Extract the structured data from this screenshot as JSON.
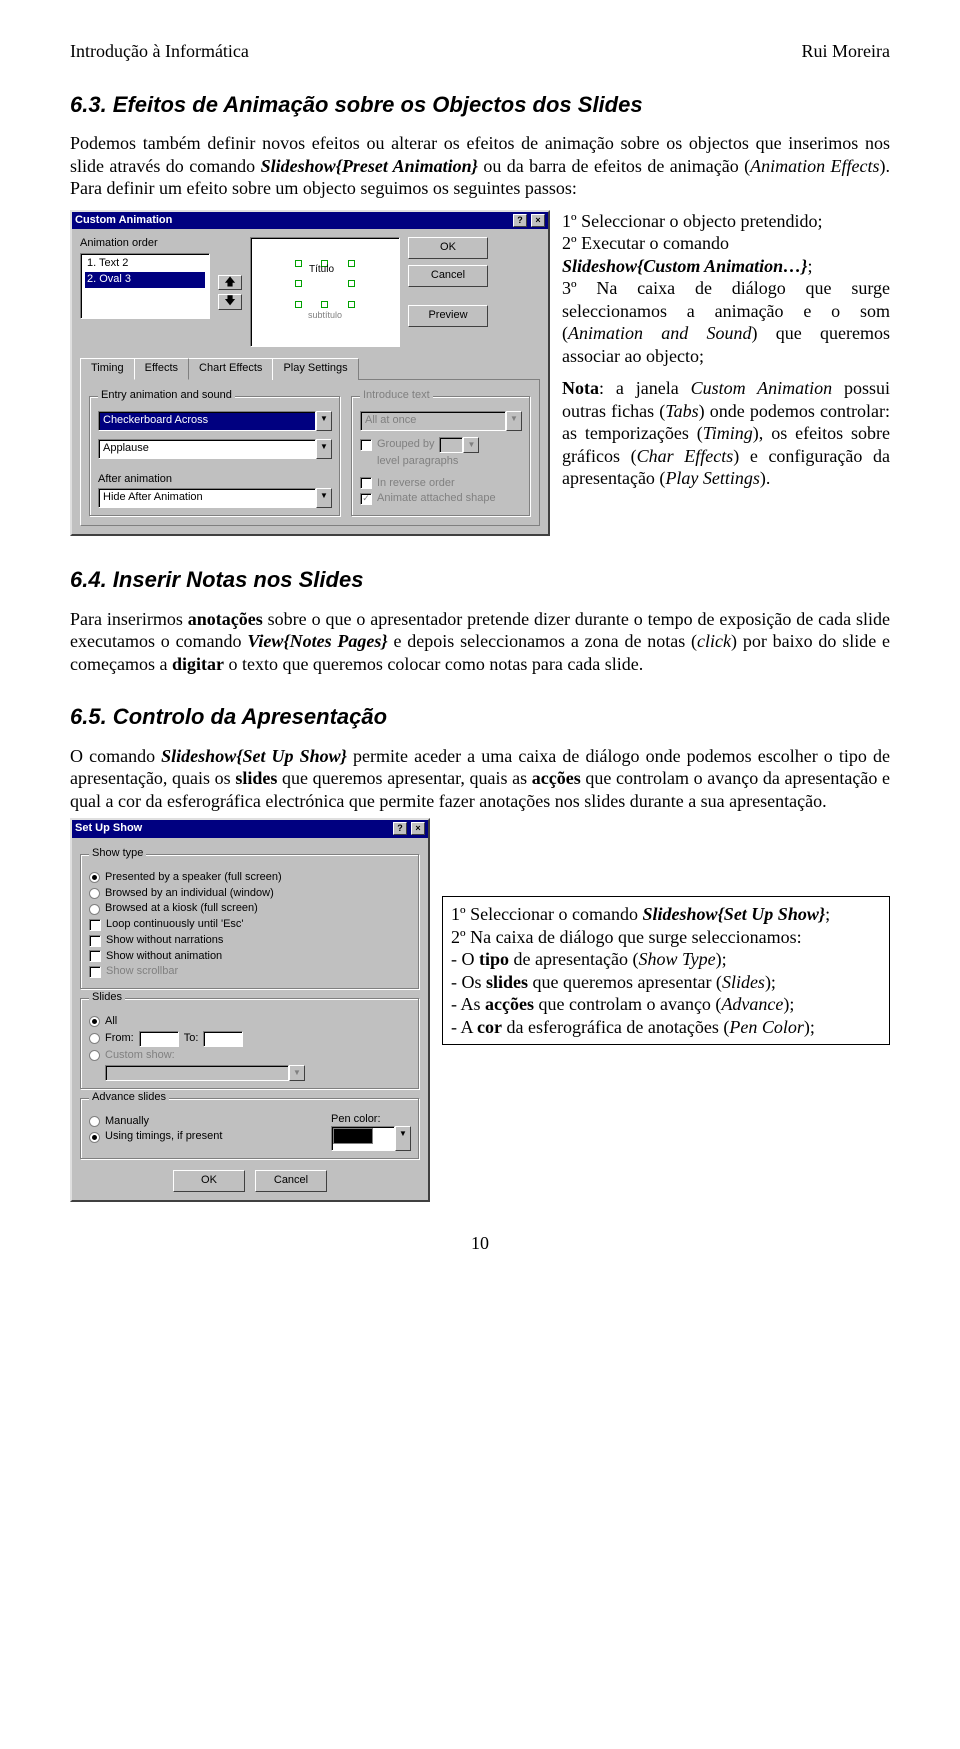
{
  "header": {
    "left": "Introdução à Informática",
    "right": "Rui Moreira"
  },
  "sec63": {
    "title": "6.3. Efeitos de Animação sobre os Objectos dos Slides",
    "p1a": "Podemos também definir novos efeitos ou alterar os efeitos de animação sobre os objectos que inserimos nos slide através do comando ",
    "p1b": "Slideshow{Preset Animation}",
    "p1c": " ou da barra de efeitos de animação (",
    "p1d": "Animation Effects",
    "p1e": "). Para definir um efeito sobre um objecto seguimos os seguintes passos:",
    "side1a": "1º Seleccionar o objecto pretendido;",
    "side1b": "2º Executar o comando",
    "side1c": "Slideshow{Custom Animation…}",
    "side1d": ";",
    "side1e": "3º Na caixa de diálogo que surge seleccionamos a animação e o som (",
    "side1f": "Animation and Sound",
    "side1g": ") que queremos associar ao objecto;",
    "note_a": "Nota",
    "note_b": ": a janela ",
    "note_c": "Custom Animation",
    "note_d": " possui outras fichas (",
    "note_e": "Tabs",
    "note_f": ") onde podemos controlar: as temporizações (",
    "note_g": "Timing",
    "note_h": "), os efeitos sobre gráficos (",
    "note_i": "Char Effects",
    "note_j": ") e configuração da apresentação (",
    "note_k": "Play Settings",
    "note_l": ")."
  },
  "dlg1": {
    "title": "Custom Animation",
    "help": "?",
    "close": "×",
    "orderLabel": "Animation order",
    "orderItems": [
      "1. Text 2",
      "2. Oval 3"
    ],
    "previewWord": "Título",
    "previewSub": "subtítulo",
    "ok": "OK",
    "cancel": "Cancel",
    "preview": "Preview",
    "tabs": [
      "Timing",
      "Effects",
      "Chart Effects",
      "Play Settings"
    ],
    "group1": "Entry animation and sound",
    "group2": "Introduce text",
    "effect": "Checkerboard Across",
    "sound": "Applause",
    "introText": "All at once",
    "afterLabel": "After animation",
    "after": "Hide After Animation",
    "groupedBy": "Grouped by",
    "levelPara": "level paragraphs",
    "reverse": "In reverse order",
    "animShape": "Animate attached shape"
  },
  "sec64": {
    "title": "6.4. Inserir Notas nos Slides",
    "p_a": "Para inserirmos ",
    "p_b": "anotações",
    "p_c": " sobre o que o apresentador pretende dizer durante o tempo de exposição de cada slide executamos o comando ",
    "p_d": "View{Notes Pages}",
    "p_e": " e depois seleccionamos a zona de notas (",
    "p_f": "click",
    "p_g": ") por baixo do slide e começamos a ",
    "p_h": "digitar",
    "p_i": " o texto que queremos colocar como notas para cada slide."
  },
  "sec65": {
    "title": "6.5. Controlo da Apresentação",
    "p1a": "O comando ",
    "p1b": "Slideshow{Set Up Show}",
    "p1c": " permite aceder a uma caixa de diálogo onde podemos escolher o tipo de apresentação, quais os ",
    "p1d": "slides",
    "p1e": " que queremos apresentar, quais as ",
    "p1f": "acções",
    "p1g": " que controlam o avanço da apresentação e qual a cor da esferográfica electrónica que permite fazer anotações nos slides durante a sua apresentação.",
    "fr_a": "1º Seleccionar o comando ",
    "fr_b": "Slideshow{Set Up Show}",
    "fr_c": ";",
    "fr_d": "2º Na caixa de diálogo que surge seleccionamos:",
    "fr_e": "- O ",
    "fr_f": "tipo",
    "fr_g": " de apresentação (",
    "fr_h": "Show Type",
    "fr_i": ");",
    "fr_j": "- Os ",
    "fr_k": "slides",
    "fr_l": " que queremos apresentar (",
    "fr_m": "Slides",
    "fr_n": ");",
    "fr_o": "- As ",
    "fr_p": "acções",
    "fr_q": " que controlam o avanço (",
    "fr_r": "Advance",
    "fr_s": ");",
    "fr_t": "- A ",
    "fr_u": "cor",
    "fr_v": " da esferográfica  de anotações (",
    "fr_w": "Pen Color",
    "fr_x": ");"
  },
  "dlg2": {
    "title": "Set Up Show",
    "help": "?",
    "close": "×",
    "showType": "Show type",
    "opt1": "Presented by a speaker (full screen)",
    "opt2": "Browsed by an individual (window)",
    "opt3": "Browsed at a kiosk (full screen)",
    "chk1": "Loop continuously until 'Esc'",
    "chk2": "Show without narrations",
    "chk3": "Show without animation",
    "chk4": "Show scrollbar",
    "slides": "Slides",
    "all": "All",
    "from": "From:",
    "to": "To:",
    "custom": "Custom show:",
    "advance": "Advance slides",
    "man": "Manually",
    "timings": "Using timings, if present",
    "pen": "Pen color:",
    "ok": "OK",
    "cancel": "Cancel"
  },
  "pageNum": "10"
}
